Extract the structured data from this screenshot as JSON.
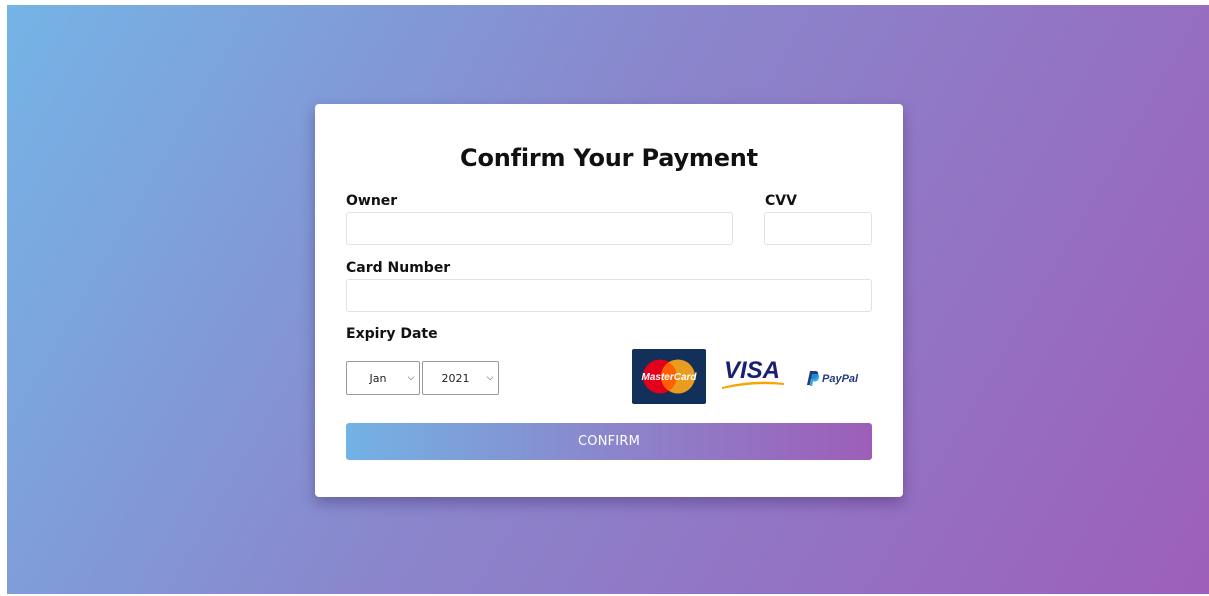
{
  "form": {
    "title": "Confirm Your Payment",
    "owner_label": "Owner",
    "owner_value": "",
    "cvv_label": "CVV",
    "cvv_value": "",
    "card_number_label": "Card Number",
    "card_number_value": "",
    "expiry_label": "Expiry Date",
    "month_selected": "Jan",
    "year_selected": "2021",
    "confirm_label": "CONFIRM"
  },
  "logos": {
    "mastercard_text": "MasterCard",
    "visa_text": "VISA",
    "paypal_text": "PayPal"
  },
  "colors": {
    "gradient_start": "#75b4e6",
    "gradient_end": "#9d5fba",
    "mastercard_bg": "#12305a",
    "mastercard_red": "#e2001a",
    "mastercard_orange": "#f7a21b",
    "visa_blue": "#1a1f71",
    "visa_gold": "#f7a600",
    "paypal_dark": "#253b80",
    "paypal_light": "#179bd7"
  }
}
